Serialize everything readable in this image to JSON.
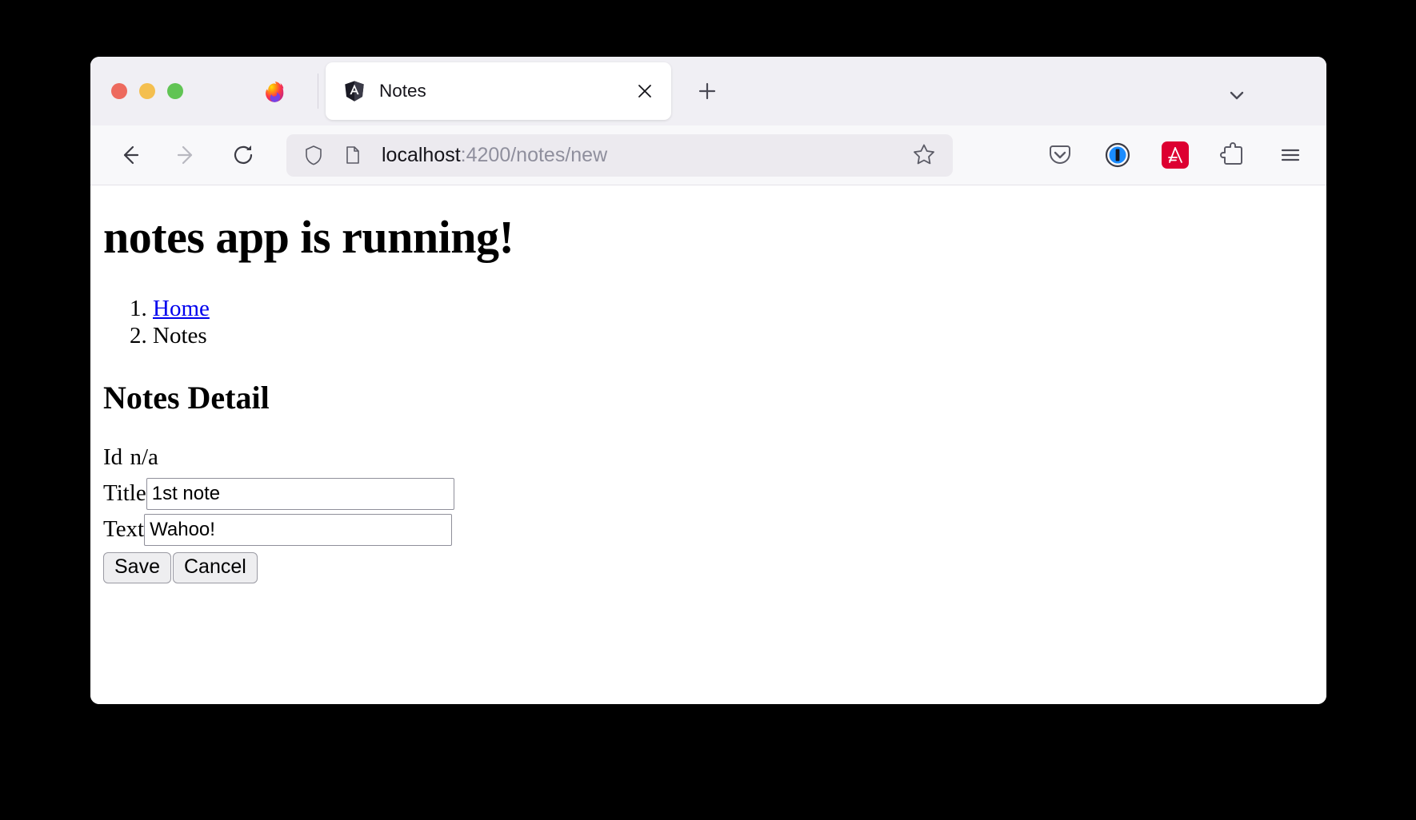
{
  "browser": {
    "window_controls": [
      "close",
      "minimize",
      "maximize"
    ],
    "app_icon": "firefox-logo",
    "tab": {
      "favicon": "angular-logo",
      "title": "Notes",
      "close_label": "×"
    },
    "new_tab_label": "+",
    "tab_list_icon": "chevron-down-icon",
    "nav": {
      "back_label": "←",
      "forward_label": "→",
      "reload_label": "↻"
    },
    "urlbar": {
      "shield_icon": "shield-icon",
      "page_icon": "page-icon",
      "host": "localhost",
      "path": ":4200/notes/new",
      "bookmark_icon": "star-icon"
    },
    "toolbar": {
      "pocket_icon": "pocket-icon",
      "onepassword_icon": "1password-icon",
      "angular_devtools_icon": "angular-devtools-icon",
      "extensions_icon": "puzzle-icon",
      "menu_icon": "hamburger-menu-icon"
    }
  },
  "page": {
    "heading": "notes app is running!",
    "breadcrumb": [
      {
        "label": "Home",
        "link": true
      },
      {
        "label": "Notes",
        "link": false
      }
    ],
    "section_heading": "Notes Detail",
    "fields": {
      "id_label": "Id",
      "id_value": "n/a",
      "title_label": "Title",
      "title_value": "1st note",
      "title_placeholder": "",
      "text_label": "Text",
      "text_value": "Wahoo!",
      "text_placeholder": ""
    },
    "buttons": {
      "save": "Save",
      "cancel": "Cancel"
    }
  },
  "colors": {
    "link": "#0000ee",
    "angular_red": "#dd0031",
    "tab_strip": "#f0eff4",
    "nav_bar": "#f8f8fa"
  }
}
